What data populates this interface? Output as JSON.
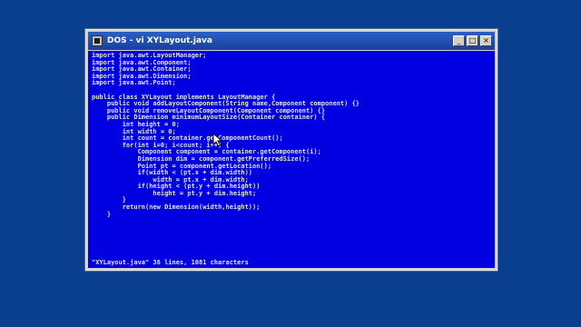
{
  "window": {
    "title": "DOS - vi XYLayout.java",
    "controls": {
      "minimize": "_",
      "maximize": "□",
      "close": "×"
    }
  },
  "editor": {
    "lines": [
      "import java.awt.LayoutManager;",
      "import java.awt.Component;",
      "import java.awt.Container;",
      "import java.awt.Dimension;",
      "import java.awt.Point;",
      "",
      "public class XYLayout implements LayoutManager {",
      "    public void addLayoutComponent(String name,Component component) {}",
      "    public void removeLayoutComponent(Component component) {}",
      "    public Dimension minimumLayoutSize(Container container) {",
      "        int height = 0;",
      "        int width = 0;",
      "        int count = container.getComponentCount();",
      "        for(int i=0; i<count; i++) {",
      "            Component component = container.getComponent(i);",
      "            Dimension dim = component.getPreferredSize();",
      "            Point pt = component.getLocation();",
      "            if(width < (pt.x + dim.width))",
      "                width = pt.x + dim.width;",
      "            if(height < (pt.y + dim.height))",
      "                height = pt.y + dim.height;",
      "        }",
      "        return(new Dimension(width,height));",
      "    }"
    ],
    "status_line": "\"XYLayout.java\" 36 lines, 1081 characters"
  }
}
